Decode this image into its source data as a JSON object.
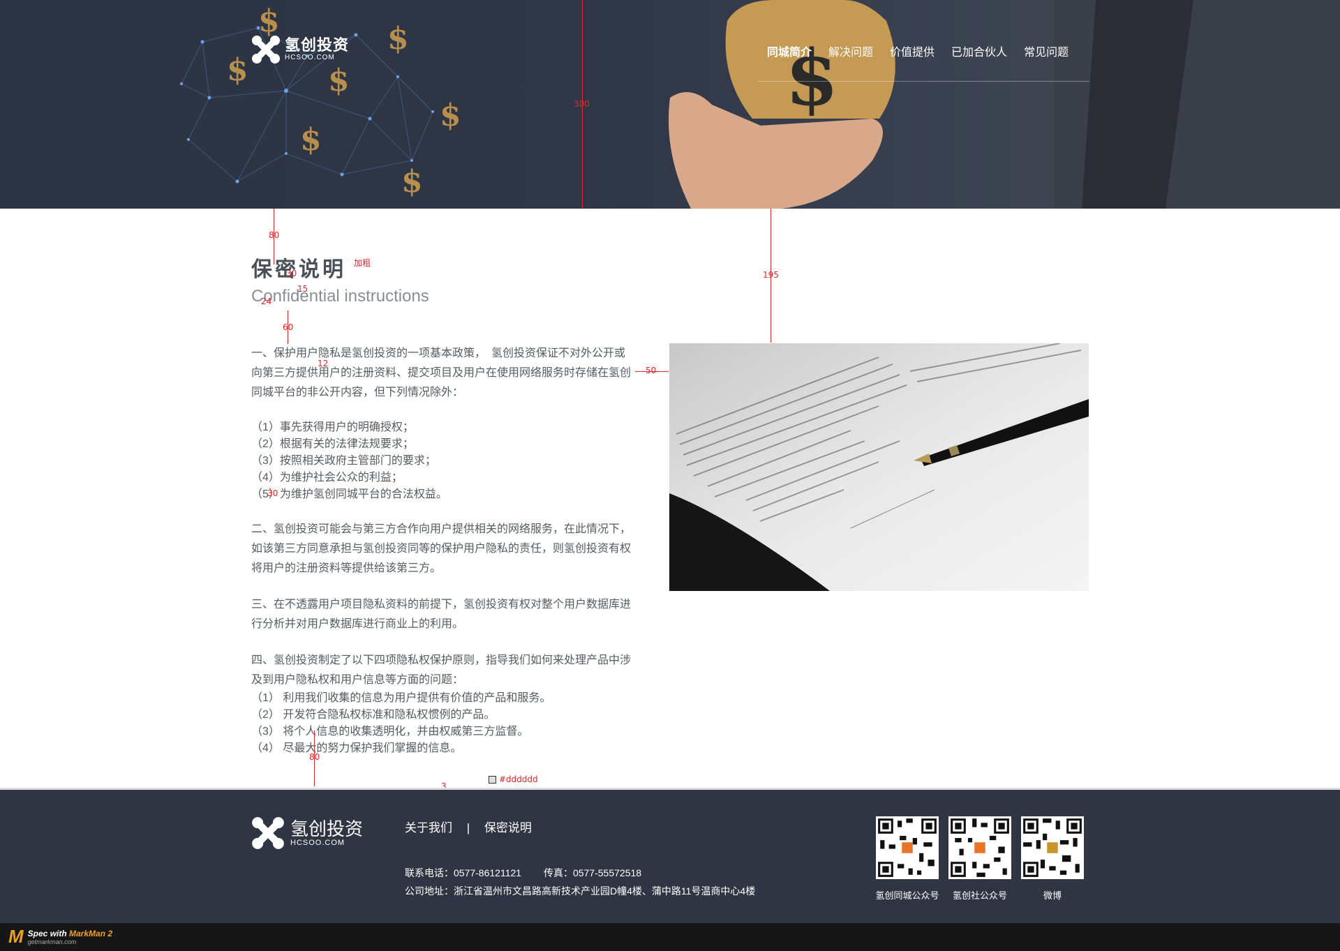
{
  "header": {
    "logo": {
      "cn": "氢创投资",
      "en": "HCSOO.COM"
    },
    "nav": [
      {
        "label": "同城简介"
      },
      {
        "label": "解决问题"
      },
      {
        "label": "价值提供"
      },
      {
        "label": "已加合伙人"
      },
      {
        "label": "常见问题"
      }
    ]
  },
  "main": {
    "title": "保密说明",
    "subtitle": "Confidential instructions",
    "sections": {
      "s1_intro": "一、保护用户隐私是氢创投资的一项基本政策，　氢创投资保证不对外公开或向第三方提供用户的注册资料、提交项目及用户在使用网络服务时存储在氢创同城平台的非公开内容，但下列情况除外：",
      "s1_items": [
        "（1）事先获得用户的明确授权；",
        "（2）根据有关的法律法规要求；",
        "（3）按照相关政府主管部门的要求；",
        "（4）为维护社会公众的利益；",
        "（5）为维护氢创同城平台的合法权益。"
      ],
      "s2": "二、氢创投资可能会与第三方合作向用户提供相关的网络服务，在此情况下，如该第三方同意承担与氢创投资同等的保护用户隐私的责任，则氢创投资有权将用户的注册资料等提供给该第三方。",
      "s3": "三、在不透露用户项目隐私资料的前提下，氢创投资有权对整个用户数据库进行分析并对用户数据库进行商业上的利用。",
      "s4_intro": "四、氢创投资制定了以下四项隐私权保护原则，指导我们如何来处理产品中涉及到用户隐私权和用户信息等方面的问题：",
      "s4_items": [
        "（1） 利用我们收集的信息为用户提供有价值的产品和服务。",
        "（2） 开发符合隐私权标准和隐私权惯例的产品。",
        "（3） 将个人信息的收集透明化，并由权威第三方监督。",
        "（4） 尽最大的努力保护我们掌握的信息。"
      ]
    }
  },
  "annotations": {
    "banner_height": "300",
    "gap_top": "80",
    "bold_note": "加粗",
    "title_size": "30",
    "gap_15": "15",
    "sub_size": "24",
    "gap_60": "60",
    "text_size": "12",
    "gap_50": "50",
    "photo_offset": "195",
    "para_gap": "30",
    "gap_bottom": "80",
    "border_width": "3",
    "border_color": "#dddddd"
  },
  "footer": {
    "logo": {
      "cn": "氢创投资",
      "en": "HCSOO.COM"
    },
    "links": [
      {
        "label": "关于我们"
      },
      {
        "label": "保密说明"
      }
    ],
    "separator": "|",
    "phone": "联系电话：0577-86121121",
    "fax": "传真：0577-55572518",
    "address": "公司地址：浙江省温州市文昌路高新技术产业园D幢4楼、蒲中路11号温商中心4楼",
    "qrcodes": [
      {
        "caption": "氢创同城公众号"
      },
      {
        "caption": "氢创社公众号"
      },
      {
        "caption": "微博"
      }
    ]
  },
  "markman": {
    "line1_a": "Spec with ",
    "line1_b": "MarkMan 2",
    "line2": "getmarkman.com",
    "m": "M"
  },
  "colors": {
    "banner_bg": "#2c3444",
    "footer_bg": "#2f3542",
    "text": "#555b61",
    "annotation": "#e0262a"
  }
}
